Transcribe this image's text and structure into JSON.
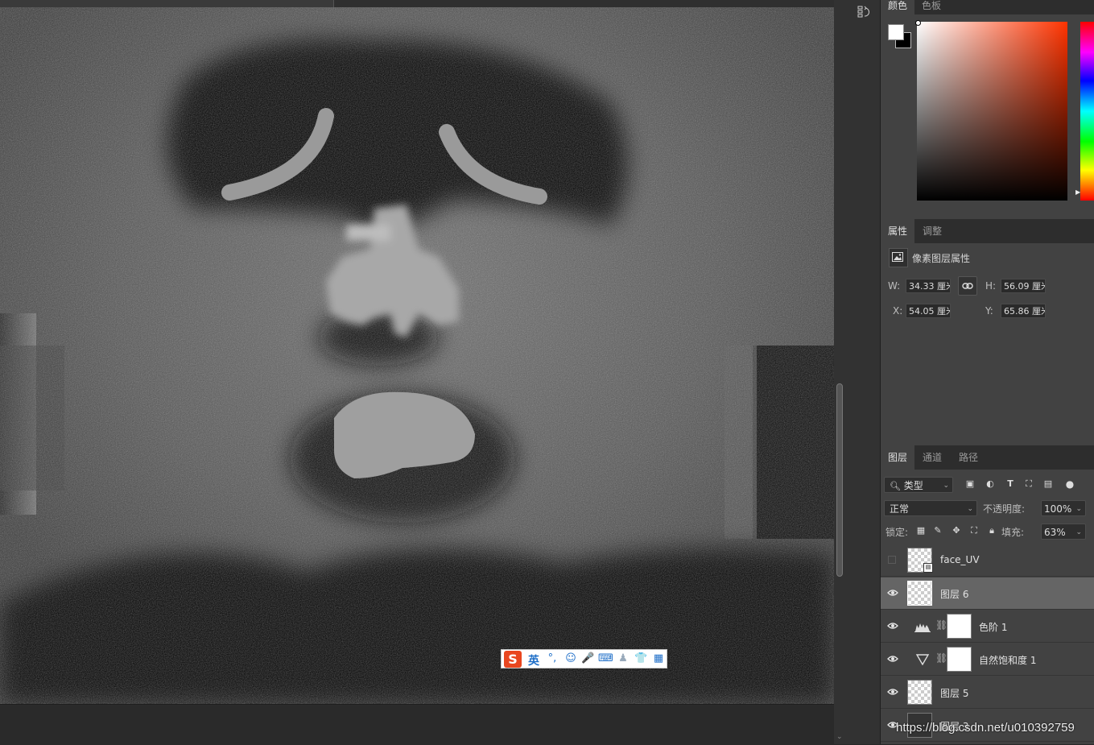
{
  "color_panel": {
    "tabs": [
      "颜色",
      "色板"
    ],
    "foreground": "#ffffff",
    "background": "#000000",
    "hue": "#ff3300"
  },
  "properties": {
    "tabs": [
      "属性",
      "调整"
    ],
    "kind_label": "像素图层属性",
    "w_label": "W:",
    "w_value": "34.33 厘米",
    "h_label": "H:",
    "h_value": "56.09 厘米",
    "x_label": "X:",
    "x_value": "54.05 厘米",
    "y_label": "Y:",
    "y_value": "65.86 厘米"
  },
  "layers_panel": {
    "tabs": [
      "图层",
      "通道",
      "路径"
    ],
    "filter_kind": "类型",
    "blend_mode": "正常",
    "opacity_label": "不透明度:",
    "opacity_value": "100%",
    "lock_label": "锁定:",
    "fill_label": "填充:",
    "fill_value": "63%",
    "layers": [
      {
        "name": "face_UV",
        "visible": false,
        "type": "smart-object"
      },
      {
        "name": "图层 6",
        "visible": true,
        "type": "pixel",
        "selected": true
      },
      {
        "name": "色阶 1",
        "visible": true,
        "type": "levels-adjustment"
      },
      {
        "name": "自然饱和度 1",
        "visible": true,
        "type": "vibrance-adjustment"
      },
      {
        "name": "图层 5",
        "visible": true,
        "type": "pixel"
      },
      {
        "name": "图层 3",
        "visible": true,
        "type": "pixel"
      }
    ]
  },
  "ime_toolbar": {
    "logo": "S",
    "language": "英"
  },
  "watermark": "https://blog.csdn.net/u010392759",
  "icons": [
    "history-icon",
    "image-icon",
    "link-icon",
    "search-icon",
    "eye-icon",
    "chain-icon",
    "levels-icon",
    "vibrance-icon",
    "smart-object-icon"
  ]
}
